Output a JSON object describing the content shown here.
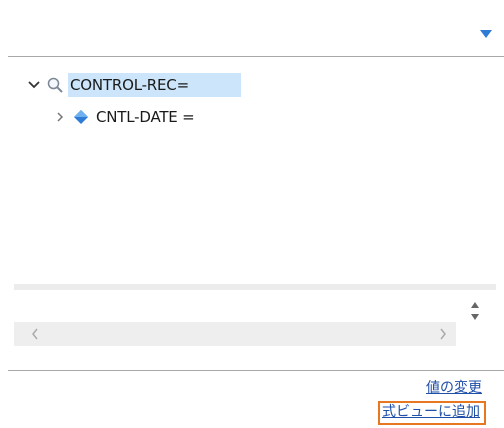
{
  "tree": {
    "items": [
      {
        "label": "CONTROL-REC=",
        "icon": "magnifier-icon",
        "expanded": true,
        "selected": true
      },
      {
        "label": "CNTL-DATE =",
        "icon": "diamond-variable-icon",
        "expanded": false,
        "selected": false
      }
    ]
  },
  "links": {
    "change_value": "値の変更",
    "add_to_expression_view": "式ビューに追加"
  },
  "colors": {
    "selection": "#cce5fb",
    "link": "#1f4fa8",
    "focus_border": "#e87722",
    "variable_icon": "#2f7cd6"
  }
}
